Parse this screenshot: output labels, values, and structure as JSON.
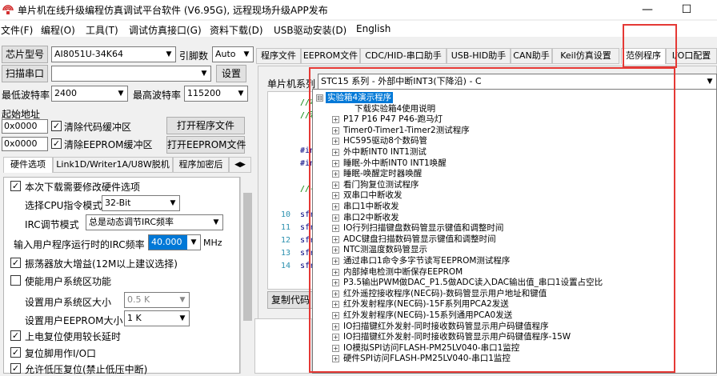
{
  "window": {
    "title": "单片机在线升级编程仿真调试平台软件 (V6.95G), 远程现场升级APP发布",
    "maximize_glyph": "☐",
    "minimize_glyph": "—"
  },
  "menu": [
    "文件(F)",
    "编程(O)",
    "工具(T)",
    "调试仿真接口(G)",
    "资料下载(D)",
    "USB驱动安装(D)",
    "English"
  ],
  "left": {
    "chip_label": "芯片型号",
    "chip_value": "AI8051U-34K64",
    "pin_label": "引脚数",
    "pin_value": "Auto",
    "scan_button": "扫描串口",
    "port_value": "",
    "settings_button": "设置",
    "min_baud_label": "最低波特率",
    "min_baud_value": "2400",
    "max_baud_label": "最高波特率",
    "max_baud_value": "115200",
    "start_addr_label": "起始地址",
    "addr1_value": "0x0000",
    "clear_code_label": "清除代码缓冲区",
    "open_program_button": "打开程序文件",
    "addr2_value": "0x0000",
    "clear_eeprom_label": "清除EEPROM缓冲区",
    "open_eeprom_button": "打开EEPROM文件",
    "tabs": [
      "硬件选项",
      "Link1D/Writer1A/U8W脱机",
      "程序加密后"
    ],
    "hw_options": {
      "modify_hw": "本次下载需要修改硬件选项",
      "cpu_mode_label": "选择CPU指令模式",
      "cpu_mode_value": "32-Bit",
      "irc_mode_label": "IRC调节模式",
      "irc_mode_value": "总是动态调节IRC频率",
      "irc_freq_label": "输入用户程序运行时的IRC频率",
      "irc_freq_value": "40.000",
      "irc_freq_unit": "MHz",
      "osc_amp": "振荡器放大增益(12M以上建议选择)",
      "user_sys_area": "使能用户系统区功能",
      "sys_area_size_label": "设置用户系统区大小",
      "sys_area_size_value": "0.5 K",
      "eeprom_size_label": "设置用户EEPROM大小",
      "eeprom_size_value": "1   K",
      "power_reset": "上电复位使用较长延时",
      "reset_pin": "复位脚用作I/O口",
      "low_voltage_reset": "允许低压复位(禁止低压中断)"
    }
  },
  "main": {
    "tabs": [
      "程序文件",
      "EEPROM文件",
      "CDC/HID-串口助手",
      "USB-HID助手",
      "CAN助手",
      "Keil仿真设置",
      "范例程序",
      "I/O口配置"
    ],
    "series_label": "单片机系列",
    "series_value": "STC15 系列 - 外部中断INT3(下降沿) - C",
    "copy_button": "复制代码",
    "code_lines": [
      {
        "ln": "",
        "src": "//本",
        "comment": true
      },
      {
        "ln": "",
        "src": "//若",
        "comment": true
      },
      {
        "ln": "",
        "src": "",
        "comment": false
      },
      {
        "ln": "",
        "src": "",
        "comment": false
      },
      {
        "ln": "",
        "src": "#inc",
        "comment": false
      },
      {
        "ln": "",
        "src": "#inc",
        "comment": false
      },
      {
        "ln": "",
        "src": "",
        "comment": false
      },
      {
        "ln": "",
        "src": "//--",
        "comment": true
      },
      {
        "ln": "",
        "src": "",
        "comment": false
      },
      {
        "ln": "10",
        "src": "sfr",
        "comment": false
      },
      {
        "ln": "11",
        "src": "sfr",
        "comment": false
      },
      {
        "ln": "12",
        "src": "sfr",
        "comment": false
      },
      {
        "ln": "13",
        "src": "sfr",
        "comment": false
      },
      {
        "ln": "14",
        "src": "sfr",
        "comment": false
      }
    ],
    "tree": [
      {
        "label": "实验箱4演示程序",
        "root": true,
        "expander": "⊟"
      },
      {
        "label": "下载实验箱4使用说明",
        "root": false,
        "expander": ""
      },
      {
        "label": "P17 P16 P47 P46-跑马灯",
        "root": false,
        "expander": "+"
      },
      {
        "label": "Timer0-Timer1-Timer2测试程序",
        "root": false,
        "expander": "+"
      },
      {
        "label": "HC595驱动8个数码管",
        "root": false,
        "expander": "+"
      },
      {
        "label": "外中断INT0 INT1测试",
        "root": false,
        "expander": "+"
      },
      {
        "label": "睡眠-外中断INT0 INT1唤醒",
        "root": false,
        "expander": "+"
      },
      {
        "label": "睡眠-唤醒定时器唤醒",
        "root": false,
        "expander": "+"
      },
      {
        "label": "看门狗复位测试程序",
        "root": false,
        "expander": "+"
      },
      {
        "label": "双串口中断收发",
        "root": false,
        "expander": "+"
      },
      {
        "label": "串口1中断收发",
        "root": false,
        "expander": "+"
      },
      {
        "label": "串口2中断收发",
        "root": false,
        "expander": "+"
      },
      {
        "label": "IO行列扫描键盘数码管显示键值和调整时间",
        "root": false,
        "expander": "+"
      },
      {
        "label": "ADC键盘扫描数码管显示键值和调整时间",
        "root": false,
        "expander": "+"
      },
      {
        "label": "NTC测温度数码管显示",
        "root": false,
        "expander": "+"
      },
      {
        "label": "通过串口1命令多字节读写EEPROM测试程序",
        "root": false,
        "expander": "+"
      },
      {
        "label": "内部掉电检测中断保存EEPROM",
        "root": false,
        "expander": "+"
      },
      {
        "label": "P3.5输出PWM做DAC_P1.5做ADC读入DAC输出值_串口1设置占空比",
        "root": false,
        "expander": "+"
      },
      {
        "label": "红外遥控接收程序(NEC码)-数码管显示用户地址和键值",
        "root": false,
        "expander": "+"
      },
      {
        "label": "红外发射程序(NEC码)-15F系列用PCA2发送",
        "root": false,
        "expander": "+"
      },
      {
        "label": "红外发射程序(NEC码)-15系列通用PCA0发送",
        "root": false,
        "expander": "+"
      },
      {
        "label": "IO扫描键红外发射-同时接收数码管显示用户码键值程序",
        "root": false,
        "expander": "+"
      },
      {
        "label": "IO扫描键红外发射-同时接收数码管显示用户码键值程序-15W",
        "root": false,
        "expander": "+"
      },
      {
        "label": "IO模拟SPI访问FLASH-PM25LV040-串口1监控",
        "root": false,
        "expander": "+"
      },
      {
        "label": "硬件SPI访问FLASH-PM25LV040-串口1监控",
        "root": false,
        "expander": "+"
      }
    ]
  },
  "colors": {
    "highlight_border": "#e53935",
    "selection": "#0078d7"
  }
}
